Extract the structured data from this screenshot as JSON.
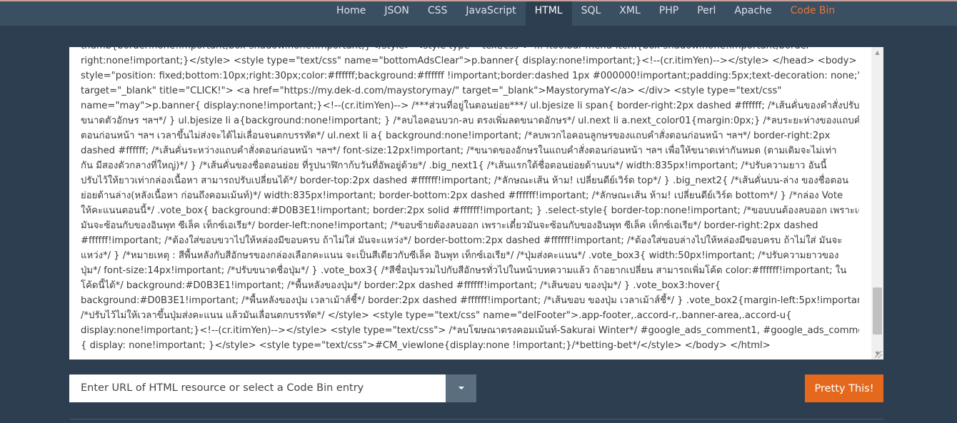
{
  "nav": {
    "items": [
      "Home",
      "JSON",
      "CSS",
      "JavaScript",
      "HTML",
      "SQL",
      "XML",
      "PHP",
      "Perl",
      "Apache",
      "Code Bin"
    ],
    "active": "HTML",
    "highlight": "Code Bin",
    "highlight_color": "#e4773b"
  },
  "editor": {
    "lines": [
      "thumb{border:none!important;box-shadow:none!important;}</style> <style type=\"text/css\"> ... .toolbar-menu-item{box-shadow:none!important;border-",
      "right:none!important;}</style>   <style type=\"text/css\" name=\"bottomAdsClear\">p.banner{  display:none!important;}<!--(cr.itimYen)--></style>  </head>  <body>     <div",
      "style=\"position: fixed;bottom:10px;right:30px;color:#ffffff;background:#ffffff !important;border:dashed 1px #000000!important;padding:5px;text-decoration: none;\"",
      "target=\"_blank\" title=\"CLICK!\">     <a href=\"https://my.dek-d.com/maystorymay/\" target=\"_blank\">MaystorymaY</a>   </div>    <style type=\"text/css\"",
      "name=\"may\">p.banner{  display:none!important;}<!--(cr.itimYen)-->     /***ส่วนที่อยู่ในตอนย่อย***/ ul.bjesize li span{ border-right:2px dashed #ffffff;  /*เส้นคั่นของคำสั่งปรับ",
      "ขนาดตัวอักษร ฯลฯ*/ } ul.bjesize li a{background:none!important; } /*ลบไอคอนบวก-ลบ ตรงเพิ่มลดขนาดอักษร*/ ul.next li a.next_color01{margin:0px;} /*ลบระยะห่างของแถบคำสั่ง",
      "ตอนก่อนหน้า ฯลฯ เวลาขึ้นไม่ส่งจะได้ไม่เลื่อนจนตกบรรทัด*/ ul.next li a{ background:none!important; /*ลบพวกไอคอนลูกษรของแถบคำสั่งตอนก่อนหน้า ฯลฯ*/ border-right:2px",
      "dashed #ffffff;  /*เส้นคั่นระหว่างแถบคำสั่งตอนก่อนหน้า ฯลฯ*/ font-size:12px!important; /*ขนาดของอักษรในแถบคำสั่งตอนก่อนหน้า ฯลฯ เพื่อให้ขนาดเท่ากันหมด (ตามเดิมจะไม่เท่า",
      "กัน มีสองตัวกลางที่ใหญ่)*/ } /*เส้นคั่นของชื่อตอนย่อย ที่รูปนาฬิกาก้บวันที่อัพอยู่ด้วย*/ .big_next1{  /*เส้นแรกใต้ชื่อตอนย่อยด้านบน*/ width:835px!important;  /*ปรับความยาว อันนี้",
      "ปรับไว้ให้ยาวเท่ากล่องเนื้อหา สามารถปรับเปลี่ยนได้*/ border-top:2px dashed #ffffff!important;  /*ลักษณะเส้น ห้าม! เปลี่ยนดีย์เวิร์ด top*/ } .big_next2{ /*เส้นคั่นบน-ล่าง ของชื่อตอน",
      "ย่อยด้านล่าง(หลังเนื้อหา ก่อนถึงคอมเม้นท์)*/ width:835px!important; border-bottom:2px dashed #ffffff!important;  /*ลักษณะเส้น ห้าม! เปลี่ยนดีย์เวิร์ด bottom*/ } /*กล่อง Vote",
      "ให้คะแนนตอนนี้*/ .vote_box{ background:#D0B3E1!important; border:2px solid #ffffff!important; }  .select-style{ border-top:none!important; /*ขอบบนต้องลบออก เพราะเดี๋ยว",
      "มันจะซ้อนกับของอินพุท ซีเล็ค เท็กซ์เอเรีย*/ border-left:none!important;  /*ขอบซ้ายต้องลบออก เพราะเดี๋ยวมันจะซ้อนกับของอินพุท ซีเล็ค เท็กซ์เอเรีย*/ border-right:2px dashed",
      "#ffffff!important; /*ต้องใส่ขอบขวาไปให้หล่องมีขอบครบ ถ้าไม่ใส่ มันจะแหว่ง*/ border-bottom:2px dashed #ffffff!important; /*ต้องใส่ขอบล่างไปให้หล่องมีขอบครบ ถ้าไม่ใส่ มันจะ",
      "แหว่ง*/ } /*หมายเหตุ : สีพื้นหลังกับสีอักษรของกล่องเลือกคะแนน จะเป็นสีเดียวกับซีเล็ค อินพุท เท็กซ์เอเรีย*/  /*ปุ่มส่งคะแนน*/ .vote_box3{ width:50px!important; /*ปรับความยาวของ",
      "ปุ่ม*/ font-size:14px!important; /*ปรับขนาดชื่อปุ่ม*/ } .vote_box3{ /*สีชื่อปุ่มรวมไปกับสีอักษรทั่วไปในหน้าบทความแล้ว ถ้าอยากเปลี่ยน สามารถเพิ่มโค้ด color:#ffffff!important; ใน",
      "โค้ดนี้ได้*/ background:#D0B3E1!important; /*พื้นหลังของปุ่ม*/ border:2px dashed #ffffff!important; /*เส้นขอบ ของปุ่ม*/ } .vote_box3:hover{",
      "background:#D0B3E1!important; /*พื้นหลังของปุ่ม เวลาเม้าส์ชี้*/ border:2px dashed #ffffff!important; /*เส้นขอบ ของปุ่ม เวลาเม้าส์ชี้*/ } .vote_box2{margin-left:5px!important;}",
      "/*ปรับไว้ไม่ให้เวลาขึ้นปุ่มส่งคะแนน แล้วมันเลื่อนตกบรรทัด*/ </style>   <style type=\"text/css\" name=\"delFooter\">.app-footer,.accord-r,.banner-area,.accord-u{",
      "display:none!important;}<!--(cr.itimYen)--></style>   <style type=\"text/css\"> /*ลบโฆษณาตรงคอมเม้นท์-Sakurai Winter*/ #google_ads_comment1, #google_ads_comment1 li",
      "{ display: none!important; }</style>   <style type=\"text/css\">#CM_viewlone{display:none !important;}/*betting-bet*/</style>  </body> </html>"
    ]
  },
  "url_input": {
    "placeholder": "Enter URL of HTML resource or select a Code Bin entry",
    "value": ""
  },
  "pretty_button": {
    "label": "Pretty This!"
  }
}
